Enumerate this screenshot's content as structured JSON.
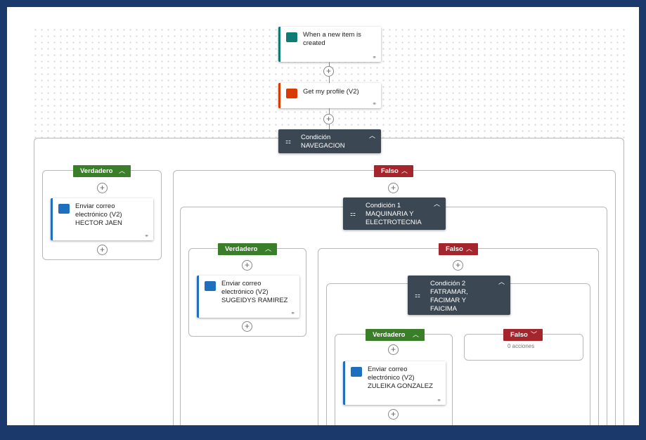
{
  "trigger": {
    "line1": "When a new item is",
    "line2": "created",
    "link_icon": "link-icon"
  },
  "profile": {
    "title": "Get my profile (V2)",
    "link_icon": "link-icon"
  },
  "condition_main": {
    "label": "Condición",
    "value": "NAVEGACION"
  },
  "branch_true_1": {
    "label": "Verdadero",
    "card_line1": "Enviar correo",
    "card_line2": "electrónico (V2)",
    "card_line3": "HECTOR JAEN"
  },
  "branch_false_1": {
    "label": "Falso"
  },
  "condition_1": {
    "label": "Condición 1",
    "value1": "MAQUINARIA Y",
    "value2": "ELECTROTECNIA"
  },
  "branch_true_2": {
    "label": "Verdadero",
    "card_line1": "Enviar correo",
    "card_line2": "electrónico (V2)",
    "card_line3": "SUGEIDYS RAMIREZ"
  },
  "branch_false_2": {
    "label": "Falso"
  },
  "condition_2": {
    "label": "Condición 2",
    "value1": "FATRAMAR,",
    "value2": "FACIMAR Y",
    "value3": "FAICIMA"
  },
  "branch_true_3": {
    "label": "Verdadero",
    "card_line1": "Enviar correo",
    "card_line2": "electrónico (V2)",
    "card_line3": "ZULEIKA GONZALEZ"
  },
  "branch_false_3": {
    "label": "Falso",
    "empty_text": "0 acciones"
  },
  "colors": {
    "true_branch": "#3b7e29",
    "false_branch": "#a4262c",
    "condition": "#3b4753",
    "office": "#d83b01",
    "outlook": "#1f6fbf",
    "sharepoint": "#0f7b75"
  }
}
